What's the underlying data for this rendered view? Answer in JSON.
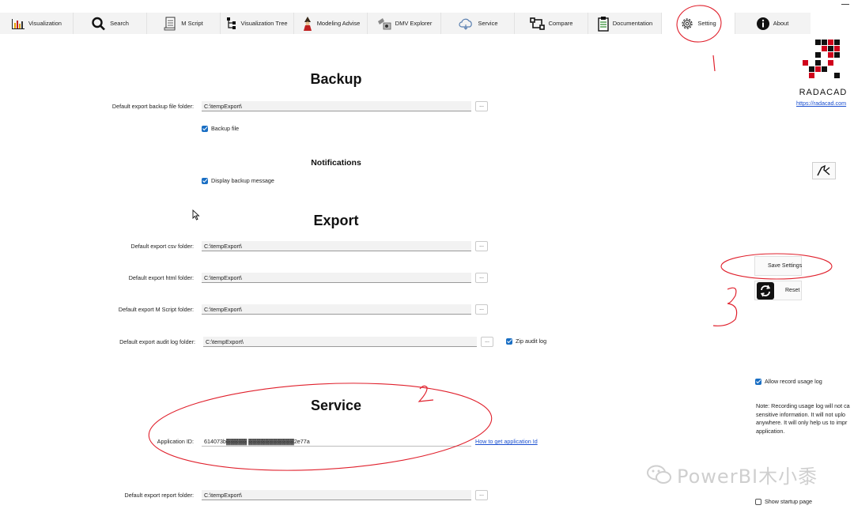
{
  "tabs": [
    {
      "label": "Visualization",
      "icon": "bar-chart-icon"
    },
    {
      "label": "Search",
      "icon": "search-icon"
    },
    {
      "label": "M Script",
      "icon": "script-icon"
    },
    {
      "label": "Visualization Tree",
      "icon": "tree-icon"
    },
    {
      "label": "Modeling Advise",
      "icon": "wizard-icon"
    },
    {
      "label": "DMV Explorer",
      "icon": "explorer-icon"
    },
    {
      "label": "Service",
      "icon": "cloud-icon"
    },
    {
      "label": "Compare",
      "icon": "compare-icon"
    },
    {
      "label": "Documentation",
      "icon": "document-icon"
    },
    {
      "label": "Setting",
      "icon": "gear-icon"
    },
    {
      "label": "About",
      "icon": "info-icon"
    }
  ],
  "active_tab": "Setting",
  "backup": {
    "title": "Backup",
    "folder_label": "Default export backup file folder:",
    "folder_value": "C:\\tempExport\\",
    "browse_label": "...",
    "backup_file_label": "Backup file"
  },
  "notifications": {
    "title": "Notifications",
    "display_backup_message_label": "Display backup message"
  },
  "export": {
    "title": "Export",
    "csv_label": "Default export csv folder:",
    "csv_value": "C:\\tempExport\\",
    "html_label": "Default export html folder:",
    "html_value": "C:\\tempExport\\",
    "mscript_label": "Default export M Script folder:",
    "mscript_value": "C:\\tempExport\\",
    "audit_label": "Default export audit log folder:",
    "audit_value": "C:\\tempExport\\",
    "zip_audit_label": "Zip audit log",
    "browse_label": "..."
  },
  "service": {
    "title": "Service",
    "app_id_label": "Application ID:",
    "app_id_value": "614073b▓▓▓▓▓ ▓▓▓▓▓▓▓▓▓▓▓2e77a",
    "how_to_link": "How to get application Id",
    "report_label": "Default export report folder:",
    "report_value": "C:\\tempExport\\",
    "browse_label": "..."
  },
  "brand": {
    "name": "RADACAD",
    "url": "https://radacad.com",
    "logo_red": "#d0021b",
    "logo_black": "#111111"
  },
  "actions": {
    "save_label": "Save Settings",
    "reset_label": "Reset"
  },
  "usage": {
    "allow_record_label": "Allow record usage log",
    "note_lines": [
      "Note: Recording usage log will not ca",
      "sensitive information. It will not uplo",
      "anywhere. It will only help us to impr",
      "application."
    ],
    "show_startup_label": "Show startup page"
  },
  "annotations": {
    "numbers": [
      "1",
      "2",
      "3"
    ],
    "color": "#e0202c"
  },
  "watermark": "PowerBI木小黍",
  "accent": "#1a6fc4"
}
